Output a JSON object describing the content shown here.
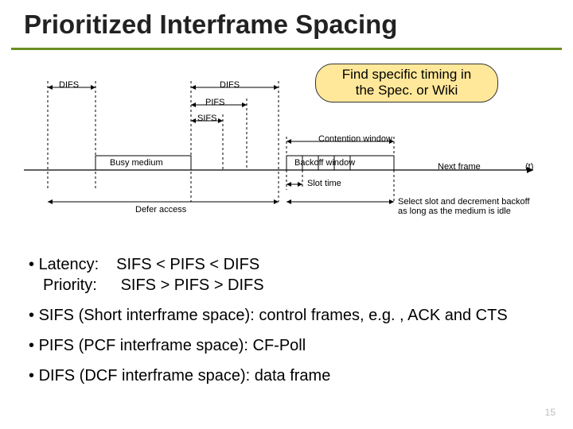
{
  "title": "Prioritized Interframe Spacing",
  "callout": {
    "line1": "Find specific timing in",
    "line2": "the Spec. or Wiki"
  },
  "diagram": {
    "difs1": "DIFS",
    "difs2": "DIFS",
    "pifs": "PIFS",
    "sifs": "SIFS",
    "busy": "Busy medium",
    "contention": "Contention window",
    "backoff": "Backoff window",
    "next": "Next frame",
    "t": "(t)",
    "slot": "Slot time",
    "defer": "Defer access",
    "select1": "Select slot and decrement backoff",
    "select2": "as long as the medium is idle"
  },
  "bullets": {
    "b1_label": "Latency:",
    "b1_value": "SIFS < PIFS < DIFS",
    "b1b_label": "Priority:",
    "b1b_value": "SIFS > PIFS > DIFS",
    "b2": "SIFS (Short interframe space): control frames, e.g. , ACK and CTS",
    "b3": "PIFS (PCF interframe space): CF-Poll",
    "b4": "DIFS (DCF interframe space): data frame"
  },
  "page": "15"
}
